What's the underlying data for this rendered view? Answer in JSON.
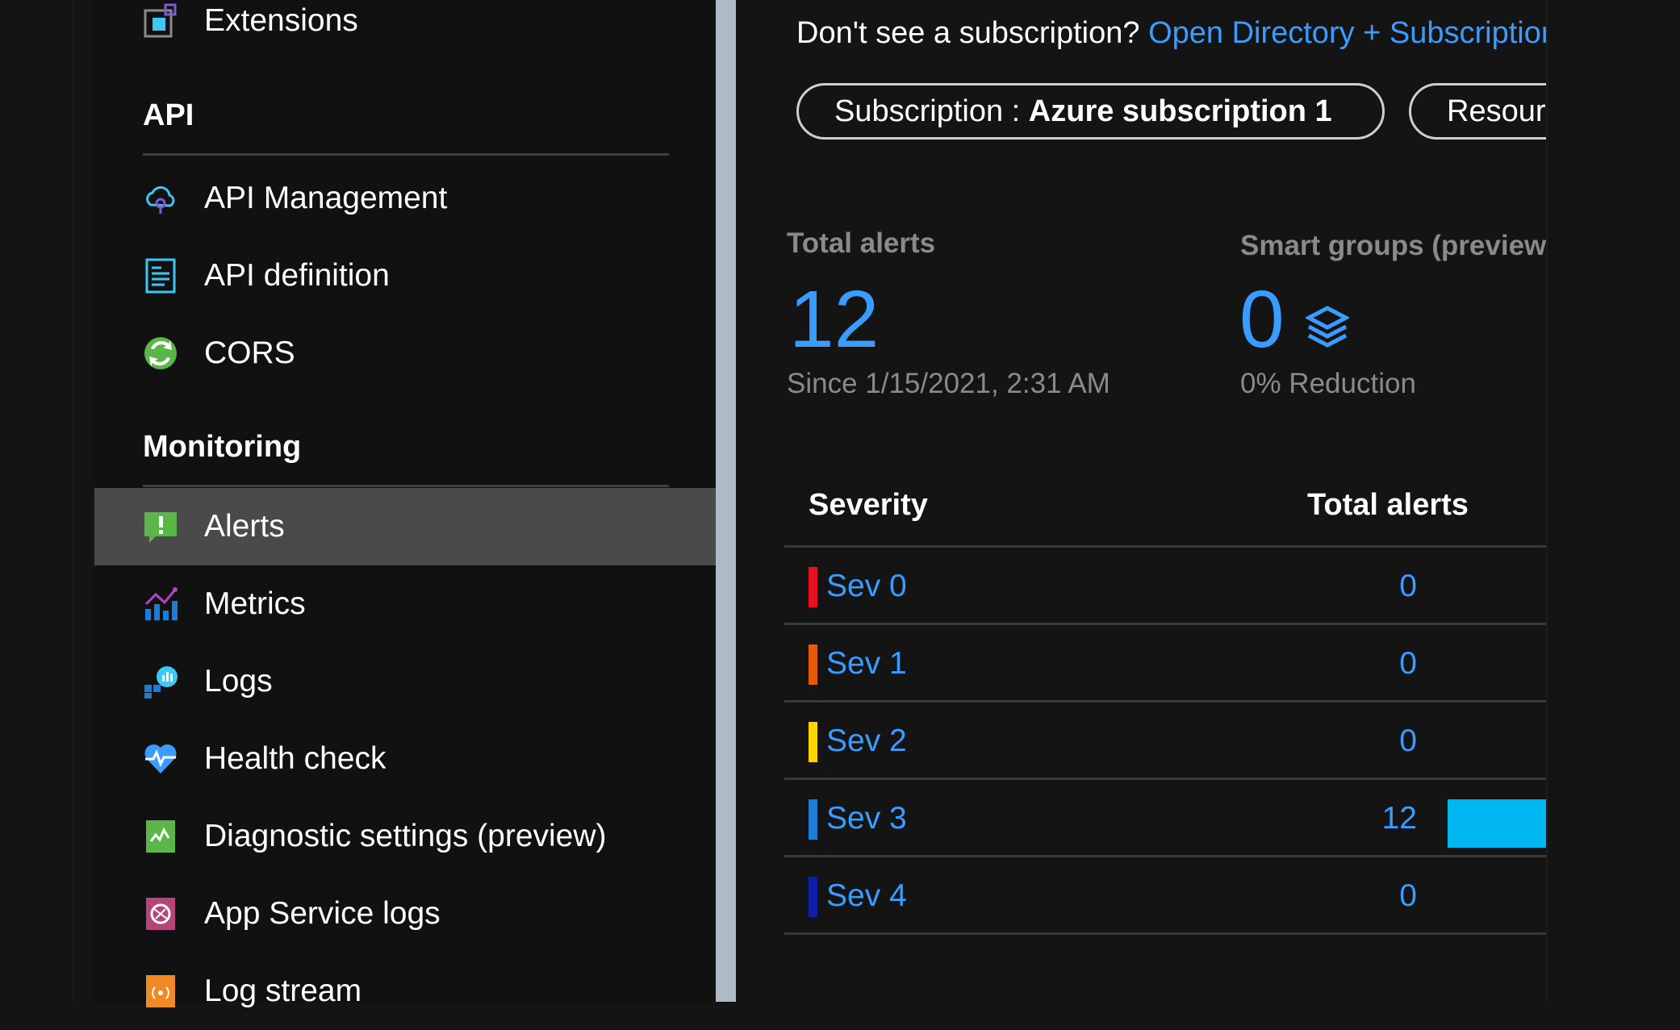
{
  "sidebar": {
    "extensions_label": "Extensions",
    "api_heading": "API",
    "api_items": [
      {
        "label": "API Management",
        "icon": "cloud-api-icon"
      },
      {
        "label": "API definition",
        "icon": "document-icon"
      },
      {
        "label": "CORS",
        "icon": "cors-globe-icon"
      }
    ],
    "monitoring_heading": "Monitoring",
    "monitoring_items": [
      {
        "label": "Alerts",
        "icon": "alert-icon",
        "selected": true
      },
      {
        "label": "Metrics",
        "icon": "metrics-chart-icon"
      },
      {
        "label": "Logs",
        "icon": "logs-icon"
      },
      {
        "label": "Health check",
        "icon": "heart-pulse-icon"
      },
      {
        "label": "Diagnostic settings (preview)",
        "icon": "diagnostic-icon"
      },
      {
        "label": "App Service logs",
        "icon": "app-service-logs-icon"
      },
      {
        "label": "Log stream",
        "icon": "log-stream-icon"
      }
    ]
  },
  "main": {
    "notice_text": "Don't see a subscription?",
    "notice_link": "Open Directory + Subscription settings",
    "filters": {
      "subscription_prefix": "Subscription : ",
      "subscription_value": "Azure subscription 1",
      "resource_group_label": "Resource group"
    },
    "total_alerts": {
      "label": "Total alerts",
      "value": "12",
      "since": "Since 1/15/2021, 2:31 AM"
    },
    "smart_groups": {
      "label": "Smart groups (preview)",
      "value": "0",
      "reduction": "0% Reduction"
    },
    "table": {
      "col_severity": "Severity",
      "col_total": "Total alerts",
      "rows": [
        {
          "name": "Sev 0",
          "count": "0",
          "color": "#e81123",
          "share": 0
        },
        {
          "name": "Sev 1",
          "count": "0",
          "color": "#e8590c",
          "share": 0
        },
        {
          "name": "Sev 2",
          "count": "0",
          "color": "#ffd400",
          "share": 0
        },
        {
          "name": "Sev 3",
          "count": "12",
          "color": "#1c7cd6",
          "share": 1
        },
        {
          "name": "Sev 4",
          "count": "0",
          "color": "#0b1fa8",
          "share": 0
        }
      ]
    }
  },
  "colors": {
    "accent": "#3b9cff",
    "bar_fill": "#00b7f1",
    "selected_bg": "#4a4a4a"
  }
}
